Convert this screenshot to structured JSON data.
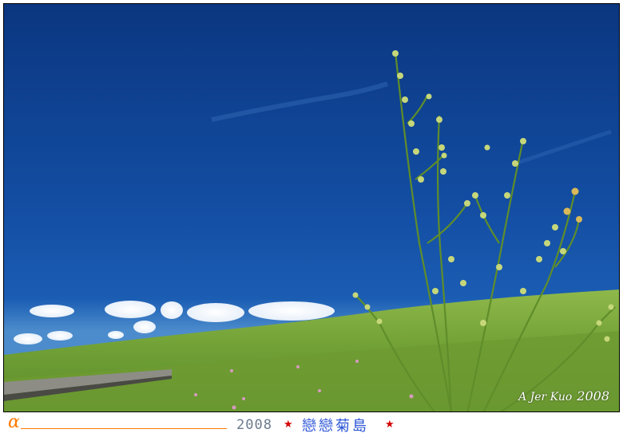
{
  "photo": {
    "subject": "Wildflower stalk against deep blue sky over grassy hillside",
    "signature_name": "A Jer Kuo",
    "signature_year": "2008"
  },
  "caption": {
    "symbol": "α",
    "year": "2008",
    "title": "戀戀菊島",
    "star": "★"
  },
  "colors": {
    "sky_dark": "#0d3a86",
    "sky_light": "#5f9ad2",
    "grass": "#7fae3a",
    "accent_orange": "#ff7a00",
    "title_blue": "#2b54d6",
    "star_red": "#d40000"
  }
}
